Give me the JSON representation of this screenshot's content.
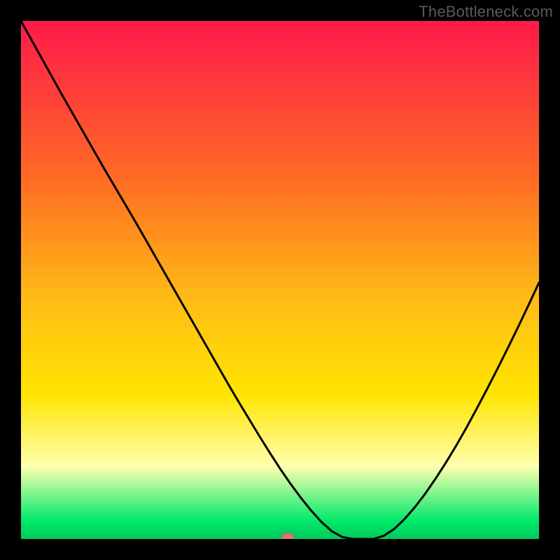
{
  "watermark": "TheBottleneck.com",
  "colors": {
    "red_top": "#ff1a4b",
    "orange": "#ff8a1f",
    "yellow": "#ffe400",
    "pale_yellow": "#ffffb0",
    "green": "#00e96a",
    "black": "#000000",
    "curve_stroke": "#000000",
    "marker_fill": "#cf7b6e",
    "marker_stroke": "#b56358"
  },
  "chart_data": {
    "type": "line",
    "title": "",
    "xlabel": "",
    "ylabel": "",
    "xlim": [
      0,
      100
    ],
    "ylim": [
      0,
      100
    ],
    "x": [
      0,
      2,
      4,
      6,
      8,
      10,
      12,
      14,
      16,
      18,
      20,
      22,
      24,
      26,
      28,
      30,
      32,
      34,
      36,
      38,
      40,
      42,
      44,
      46,
      48,
      50,
      52,
      54,
      56,
      58,
      60,
      62,
      64,
      66,
      68,
      70,
      72,
      74,
      76,
      78,
      80,
      82,
      84,
      86,
      88,
      90,
      92,
      94,
      96,
      98,
      100
    ],
    "y": [
      100,
      96.4,
      92.8,
      89.2,
      85.6,
      82.1,
      78.6,
      75.1,
      71.6,
      68.2,
      64.8,
      61.4,
      57.9,
      54.4,
      50.9,
      47.4,
      43.9,
      40.4,
      36.9,
      33.4,
      29.9,
      26.5,
      23.2,
      19.9,
      16.7,
      13.6,
      10.7,
      8.0,
      5.5,
      3.3,
      1.5,
      0.4,
      0,
      0,
      0,
      0.6,
      1.9,
      3.8,
      6.1,
      8.7,
      11.6,
      14.7,
      18.0,
      21.5,
      25.2,
      29.0,
      32.9,
      36.9,
      41.0,
      45.2,
      49.5
    ],
    "marker": {
      "x": 51.5,
      "y": 0.3
    },
    "gradient_stops": [
      {
        "offset": 0.0,
        "color": "#ff1a4b"
      },
      {
        "offset": 0.3,
        "color": "#ff6a25"
      },
      {
        "offset": 0.55,
        "color": "#ffbf15"
      },
      {
        "offset": 0.72,
        "color": "#ffe400"
      },
      {
        "offset": 0.86,
        "color": "#ffffb0"
      },
      {
        "offset": 0.965,
        "color": "#00e96a"
      },
      {
        "offset": 1.0,
        "color": "#00c95a"
      }
    ]
  }
}
